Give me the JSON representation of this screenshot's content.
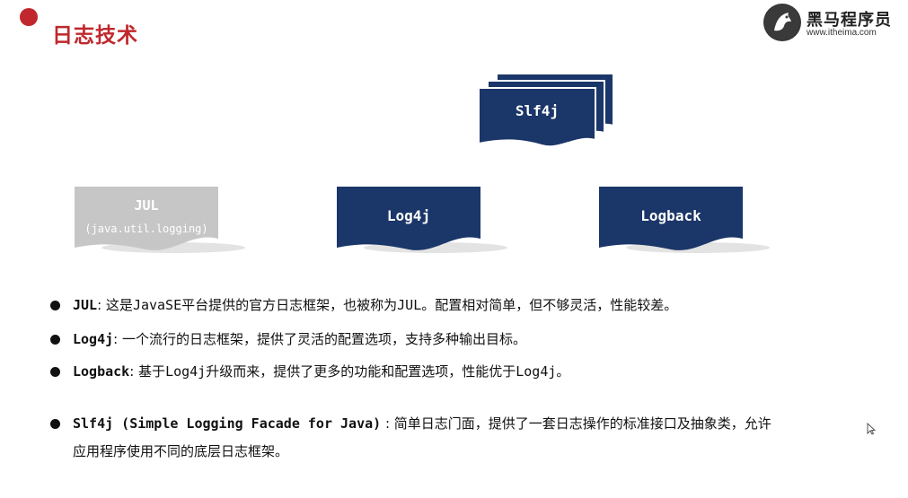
{
  "header": {
    "title": "日志技术",
    "brand_name": "黑马程序员",
    "brand_url": "www.itheima.com"
  },
  "diagram": {
    "slf4j": "Slf4j",
    "jul_title": "JUL",
    "jul_subtitle": "(java.util.logging)",
    "log4j": "Log4j",
    "logback": "Logback"
  },
  "bullets": [
    {
      "term": "JUL",
      "sep": ": ",
      "parts": [
        "这是",
        "JavaSE",
        "平台提供的官方日志框架，也被称为",
        "JUL",
        "。配置相对简单，但不够灵活，性能较差。"
      ]
    },
    {
      "term": "Log4j",
      "sep": ": ",
      "parts": [
        "一个流行的日志框架，提供了灵活的配置选项，支持多种输出目标。"
      ]
    },
    {
      "term": "Logback",
      "sep": ": ",
      "parts": [
        "基于",
        "Log4j",
        "升级而来，提供了更多的功能和配置选项，性能优于",
        "Log4j",
        "。"
      ]
    },
    {
      "term": "Slf4j (Simple Logging Facade for Java)",
      "sep": " : ",
      "parts": [
        "简单日志门面，提供了一套日志操作的标准接口及抽象类，允许",
        "应用程序使用不同的底层日志框架。"
      ]
    }
  ],
  "colors": {
    "accent": "#c0282d",
    "doc_navy": "#1b3668",
    "doc_gray": "#c6c6c6"
  }
}
